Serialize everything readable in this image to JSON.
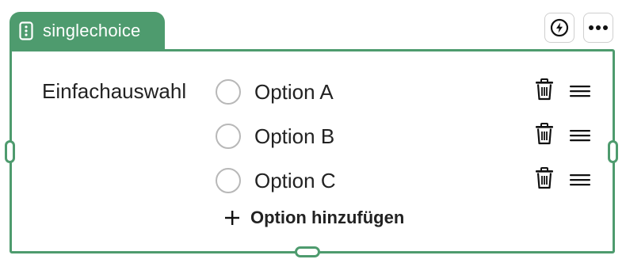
{
  "block": {
    "type_label": "singlechoice",
    "type_icon": "vertical-dots-icon",
    "accent_color": "#4e9b6e"
  },
  "toolbar": {
    "automation_icon": "lightning-bolt-icon",
    "more_icon": "more-horizontal-icon"
  },
  "question": {
    "label": "Einfachauswahl"
  },
  "options": [
    {
      "label": "Option A"
    },
    {
      "label": "Option B"
    },
    {
      "label": "Option C"
    }
  ],
  "row_actions": {
    "delete_icon": "trash-icon",
    "drag_icon": "drag-handle-icon"
  },
  "add_option": {
    "label": "Option hinzufügen",
    "icon": "plus-icon"
  }
}
